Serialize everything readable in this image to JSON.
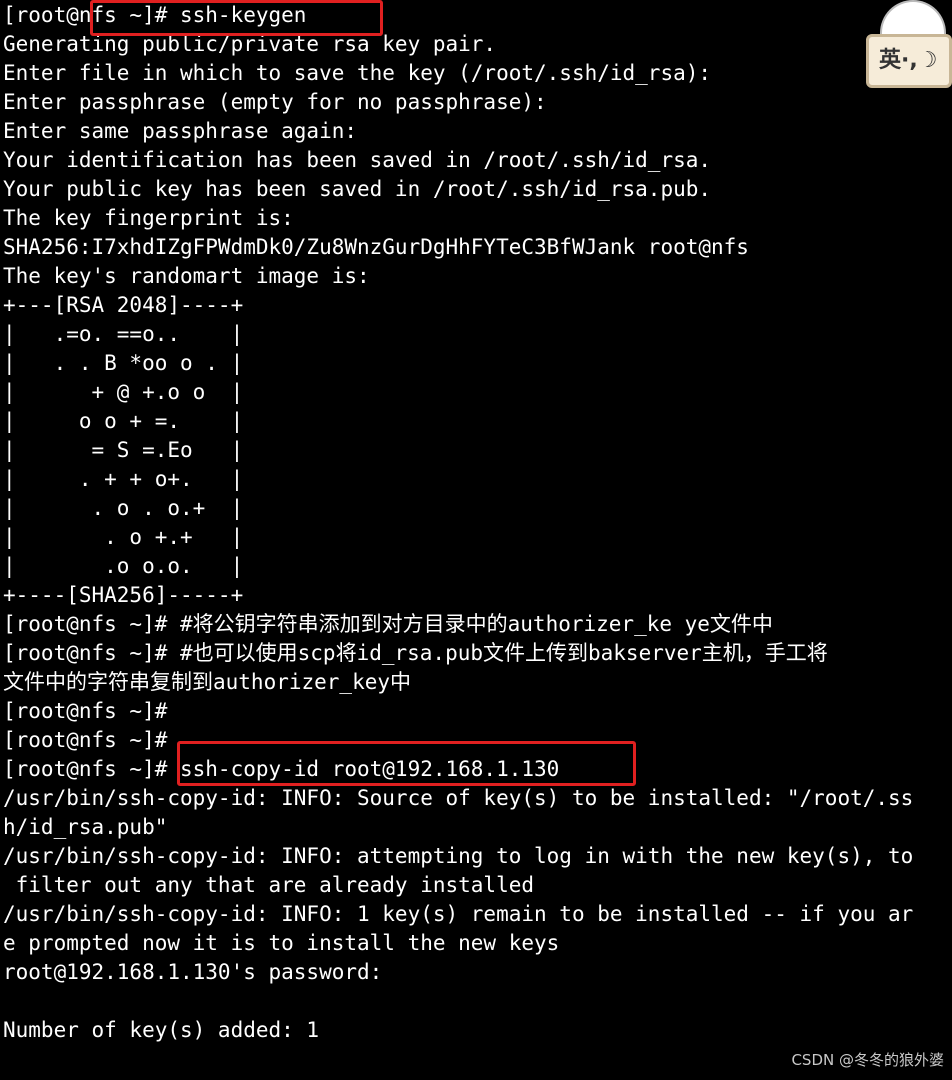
{
  "terminal": {
    "lines": [
      "[root@nfs ~]# ssh-keygen",
      "Generating public/private rsa key pair.",
      "Enter file in which to save the key (/root/.ssh/id_rsa):",
      "Enter passphrase (empty for no passphrase):",
      "Enter same passphrase again:",
      "Your identification has been saved in /root/.ssh/id_rsa.",
      "Your public key has been saved in /root/.ssh/id_rsa.pub.",
      "The key fingerprint is:",
      "SHA256:I7xhdIZgFPWdmDk0/Zu8WnzGurDgHhFYTeC3BfWJank root@nfs",
      "The key's randomart image is:",
      "+---[RSA 2048]----+",
      "|   .=o. ==o..    |",
      "|   . . B *oo o . |",
      "|      + @ +.o o  |",
      "|     o o + =.    |",
      "|      = S =.Eo   |",
      "|     . + + o+.   |",
      "|      . o . o.+  |",
      "|       . o +.+   |",
      "|       .o o.o.   |",
      "+----[SHA256]-----+",
      "[root@nfs ~]# #将公钥字符串添加到对方目录中的authorizer_ke ye文件中",
      "[root@nfs ~]# #也可以使用scp将id_rsa.pub文件上传到bakserver主机，手工将",
      "文件中的字符串复制到authorizer_key中",
      "[root@nfs ~]#",
      "[root@nfs ~]#",
      "[root@nfs ~]# ssh-copy-id root@192.168.1.130",
      "/usr/bin/ssh-copy-id: INFO: Source of key(s) to be installed: \"/root/.ss",
      "h/id_rsa.pub\"",
      "/usr/bin/ssh-copy-id: INFO: attempting to log in with the new key(s), to",
      " filter out any that are already installed",
      "/usr/bin/ssh-copy-id: INFO: 1 key(s) remain to be installed -- if you ar",
      "e prompted now it is to install the new keys",
      "root@192.168.1.130's password:",
      "",
      "Number of key(s) added: 1"
    ]
  },
  "ime": {
    "label": "英·,☽"
  },
  "watermark": "CSDN @冬冬的狼外婆",
  "colors": {
    "background": "#000000",
    "text": "#ffffff",
    "highlight": "#e02020"
  }
}
